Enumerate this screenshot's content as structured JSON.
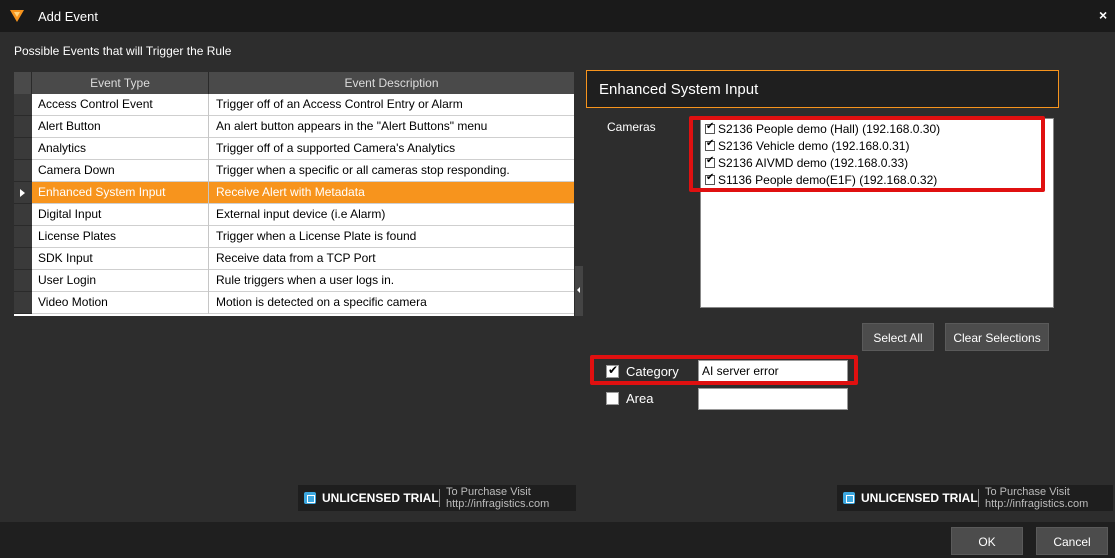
{
  "window": {
    "title": "Add Event",
    "close_glyph": "×"
  },
  "section_label": "Possible Events that will Trigger the Rule",
  "grid": {
    "columns": [
      "Event Type",
      "Event Description"
    ],
    "selected_index": 4,
    "rows": [
      {
        "type": "Access Control Event",
        "description": "Trigger off of an Access Control Entry or Alarm"
      },
      {
        "type": "Alert Button",
        "description": "An alert button appears in the \"Alert Buttons\" menu"
      },
      {
        "type": "Analytics",
        "description": "Trigger off of a supported Camera's Analytics"
      },
      {
        "type": "Camera Down",
        "description": "Trigger when a specific or all cameras stop responding."
      },
      {
        "type": "Enhanced System Input",
        "description": "Receive Alert with Metadata"
      },
      {
        "type": "Digital Input",
        "description": "External input device (i.e Alarm)"
      },
      {
        "type": "License Plates",
        "description": "Trigger when a License Plate is found"
      },
      {
        "type": "SDK Input",
        "description": "Receive data from a TCP Port"
      },
      {
        "type": "User Login",
        "description": "Rule triggers when a user logs in."
      },
      {
        "type": "Video Motion",
        "description": "Motion is detected on a specific camera"
      }
    ]
  },
  "panel": {
    "title": "Enhanced System Input",
    "cameras_label": "Cameras",
    "cameras": [
      {
        "label": "S2136 People demo (Hall) (192.168.0.30)",
        "checked": true
      },
      {
        "label": "S2136 Vehicle demo (192.168.0.31)",
        "checked": true
      },
      {
        "label": "S2136 AIVMD demo (192.168.0.33)",
        "checked": true
      },
      {
        "label": "S1136 People demo(E1F) (192.168.0.32)",
        "checked": true
      }
    ],
    "select_all_label": "Select All",
    "clear_label": "Clear Selections",
    "category": {
      "label": "Category",
      "checked": true,
      "value": "AI server error"
    },
    "area": {
      "label": "Area",
      "checked": false,
      "value": ""
    }
  },
  "trial_banner": {
    "text": "UNLICENSED TRIAL",
    "line1": "To Purchase Visit",
    "line2": "http://infragistics.com"
  },
  "footer": {
    "ok_label": "OK",
    "cancel_label": "Cancel"
  },
  "colors": {
    "accent": "#f7941d",
    "highlight_box": "#e01010",
    "background": "#2d2d2d"
  }
}
